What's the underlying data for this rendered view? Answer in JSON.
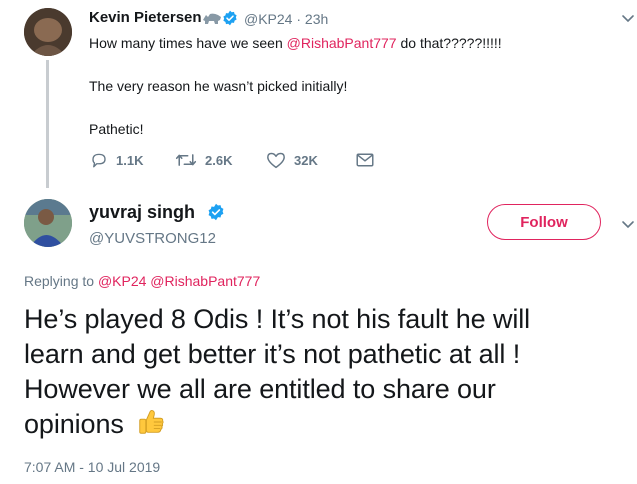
{
  "parent_tweet": {
    "author_name": "Kevin Pietersen",
    "meta": "@KP24 · 23h",
    "text_prefix": "How many times have we seen ",
    "text_mention": "@RishabPant777",
    "text_suffix": " do that?????!!!!!",
    "line2": "The very reason he wasn’t picked initially!",
    "line3": "Pathetic!",
    "replies": "1.1K",
    "retweets": "2.6K",
    "likes": "32K",
    "icons": [
      "rhino-emoji-icon",
      "verified-badge-icon",
      "chevron-down-icon",
      "reply-icon",
      "retweet-icon",
      "like-icon",
      "direct-message-icon"
    ]
  },
  "reply_tweet": {
    "author_name": "yuvraj singh",
    "handle": "@YUVSTRONG12",
    "follow_label": "Follow",
    "replying_to_label": "Replying to ",
    "replying_to_1": "@KP24",
    "replying_to_2": "@RishabPant777",
    "body_lines": [
      "He’s played 8 Odis ! It’s not his fault he will",
      "learn and get better it’s not pathetic at all !",
      "However we all are entitled to share our",
      "opinions"
    ],
    "timestamp": "7:07 AM - 10 Jul 2019",
    "icons": [
      "verified-badge-icon",
      "chevron-down-icon",
      "thumbs-up-emoji-icon"
    ]
  },
  "colors": {
    "accent": "#e0245e",
    "verified": "#1da1f2",
    "secondary_text": "#657786",
    "primary_text": "#14171a",
    "thread_line": "#c8ccd0"
  }
}
